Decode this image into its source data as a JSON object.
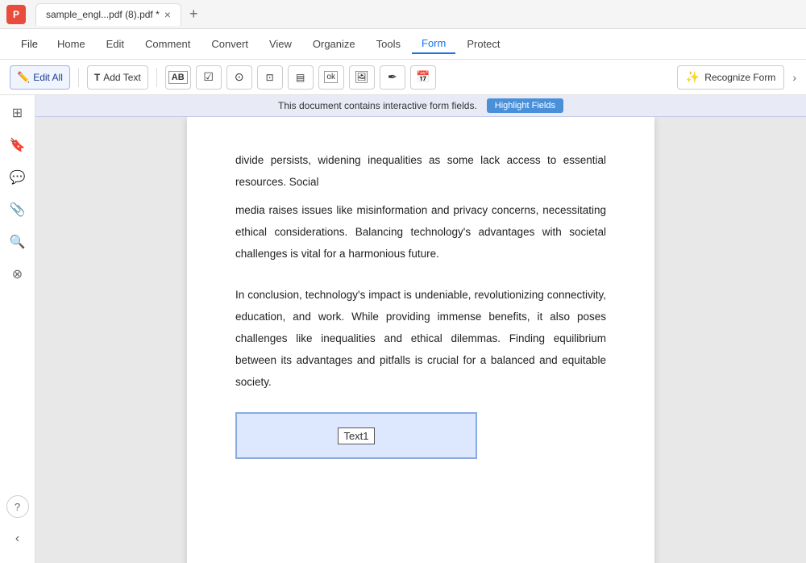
{
  "app": {
    "logo": "P",
    "tab_title": "sample_engl...pdf (8).pdf *",
    "tab_close": "×",
    "tab_add": "+"
  },
  "menubar": {
    "file_label": "File",
    "items": [
      {
        "id": "home",
        "label": "Home",
        "active": false
      },
      {
        "id": "edit",
        "label": "Edit",
        "active": false
      },
      {
        "id": "comment",
        "label": "Comment",
        "active": false
      },
      {
        "id": "convert",
        "label": "Convert",
        "active": false
      },
      {
        "id": "view",
        "label": "View",
        "active": false
      },
      {
        "id": "organize",
        "label": "Organize",
        "active": false
      },
      {
        "id": "tools",
        "label": "Tools",
        "active": false
      },
      {
        "id": "form",
        "label": "Form",
        "active": true
      },
      {
        "id": "protect",
        "label": "Protect",
        "active": false
      }
    ]
  },
  "toolbar": {
    "edit_all_label": "Edit All",
    "add_text_label": "Add Text",
    "recognize_form_label": "Recognize Form",
    "icons": {
      "text_icon": "T",
      "checkbox_icon": "☑",
      "radio_icon": "⊙",
      "dropdown_icon": "▤",
      "listbox_icon": "▤",
      "ok_icon": "ok",
      "image_icon": "🖼",
      "signature_icon": "✒",
      "date_icon": "📅"
    }
  },
  "notification": {
    "message": "This document contains interactive form fields.",
    "button_label": "Highlight Fields"
  },
  "sidebar": {
    "icons": [
      {
        "id": "thumbnail",
        "symbol": "⊞"
      },
      {
        "id": "bookmark",
        "symbol": "🔖"
      },
      {
        "id": "comment",
        "symbol": "💬"
      },
      {
        "id": "attachment",
        "symbol": "📎"
      },
      {
        "id": "search",
        "symbol": "🔍"
      },
      {
        "id": "layers",
        "symbol": "⊗"
      }
    ],
    "bottom_icons": [
      {
        "id": "help",
        "symbol": "?"
      },
      {
        "id": "collapse",
        "symbol": "‹"
      }
    ]
  },
  "pdf_content": {
    "top_text": "divide persists, widening inequalities as some lack access to essential resources. Social",
    "paragraph1": "media raises issues like misinformation and privacy concerns, necessitating ethical considerations. Balancing technology's advantages with societal challenges is vital for a harmonious future.",
    "paragraph2": "In conclusion, technology's impact is undeniable, revolutionizing connectivity, education, and work. While providing immense benefits, it also poses challenges like inequalities and ethical dilemmas. Finding equilibrium between its advantages and pitfalls is crucial for a balanced and equitable society.",
    "text_field_label": "Text1"
  },
  "colors": {
    "active_menu": "#1a73e8",
    "highlight_btn": "#4a90d9",
    "notification_bg": "#e8eaf6",
    "text_field_border": "#8aabe0",
    "text_field_bg": "#dde8ff"
  }
}
